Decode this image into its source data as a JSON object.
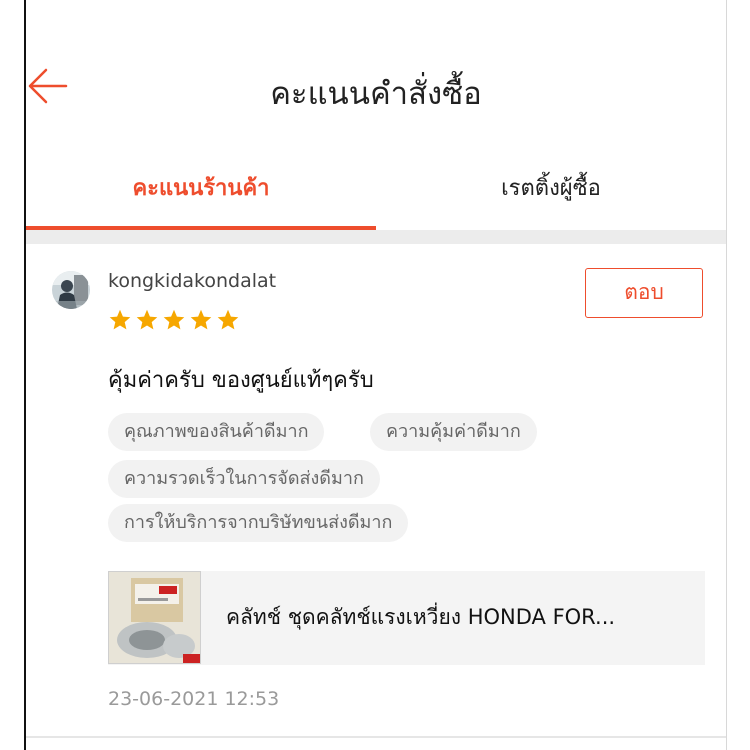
{
  "header": {
    "title": "คะแนนคำสั่งซื้อ",
    "back_icon": "arrow-left-icon",
    "accent_color": "#ee4d2d"
  },
  "tabs": [
    {
      "label": "คะแนนร้านค้า",
      "active": true
    },
    {
      "label": "เรตติ้งผู้ซื้อ",
      "active": false
    }
  ],
  "review": {
    "username": "kongkidakondalat",
    "rating": 5,
    "star_color": "#f6a700",
    "reply_label": "ตอบ",
    "comment": "คุ้มค่าครับ ของศูนย์แท้ๆครับ",
    "tags": [
      "คุณภาพของสินค้าดีมาก",
      "ความคุ้มค่าดีมาก",
      "ความรวดเร็วในการจัดส่งดีมาก",
      "การให้บริการจากบริษัทขนส่งดีมาก"
    ],
    "product": {
      "name": "คลัทช์ ชุดคลัทช์แรงเหวี่ยง HONDA FOR..."
    },
    "timestamp": "23-06-2021 12:53"
  }
}
